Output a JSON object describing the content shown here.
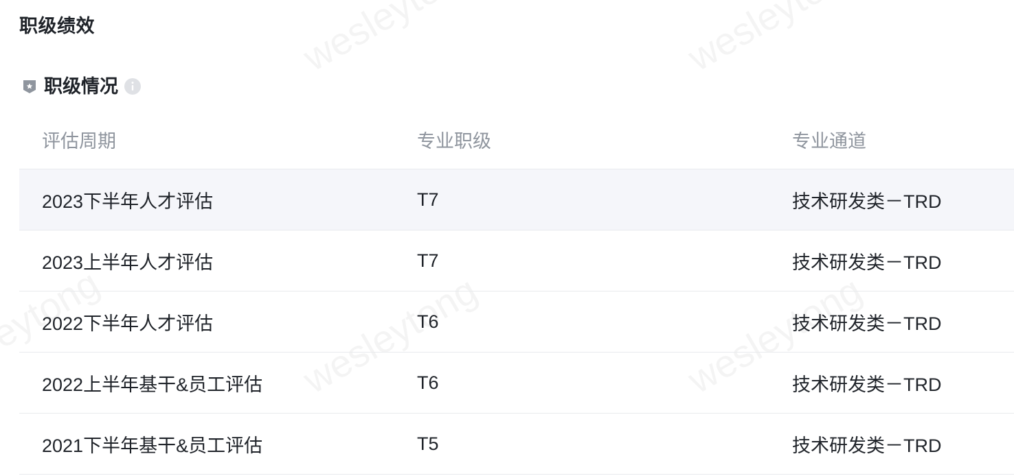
{
  "page": {
    "title": "职级绩效"
  },
  "section": {
    "title": "职级情况",
    "icon": "shield-badge-icon",
    "info_icon": "info-icon"
  },
  "table": {
    "headers": [
      "评估周期",
      "专业职级",
      "专业通道"
    ],
    "rows": [
      [
        "2023下半年人才评估",
        "T7",
        "技术研发类－TRD"
      ],
      [
        "2023上半年人才评估",
        "T7",
        "技术研发类－TRD"
      ],
      [
        "2022下半年人才评估",
        "T6",
        "技术研发类－TRD"
      ],
      [
        "2022上半年基干&员工评估",
        "T6",
        "技术研发类－TRD"
      ],
      [
        "2021下半年基干&员工评估",
        "T5",
        "技术研发类－TRD"
      ]
    ]
  },
  "watermark": {
    "text": "wesleytong"
  },
  "colors": {
    "text": "#1f2329",
    "header_text": "#8f959e",
    "row_highlight": "#f5f6fa",
    "divider": "#e8eaed",
    "icon_gray": "#8f959e"
  }
}
